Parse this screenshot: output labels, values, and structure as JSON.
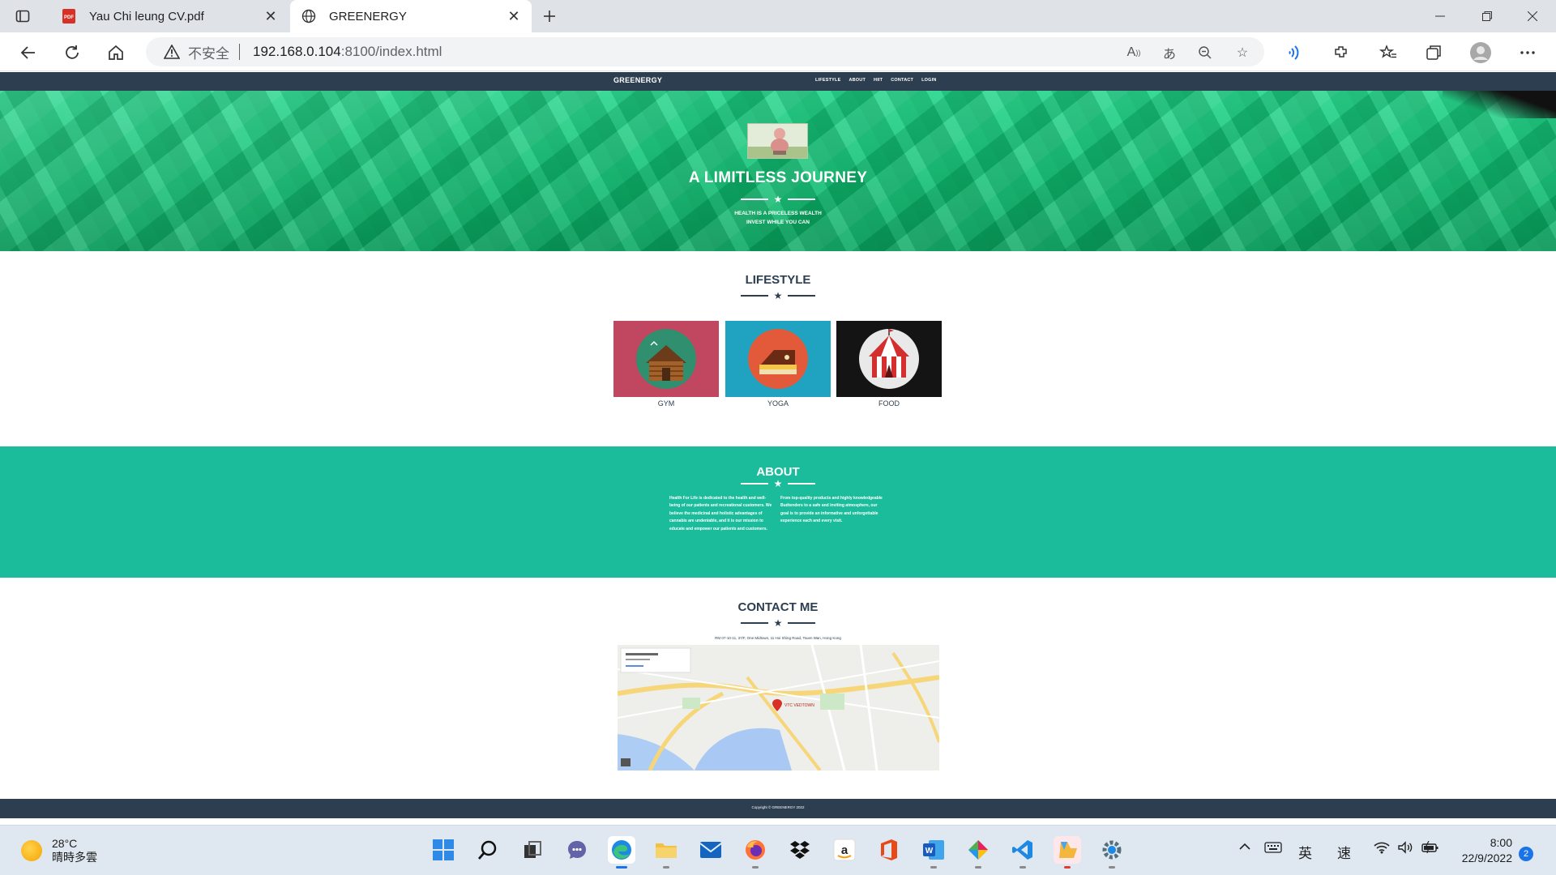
{
  "browser": {
    "tabs": [
      {
        "title": "Yau Chi leung CV.pdf",
        "icon": "pdf-icon"
      },
      {
        "title": "GREENERGY",
        "icon": "globe-icon"
      }
    ],
    "address": {
      "security": "不安全",
      "host": "192.168.0.104",
      "path": ":8100/index.html"
    }
  },
  "site": {
    "brand": "GREENERGY",
    "nav": [
      "LIFESTYLE",
      "ABOUT",
      "HIIT",
      "CONTACT",
      "LOGIN"
    ],
    "hero": {
      "title": "A LIMITLESS JOURNEY",
      "subtitle_line1": "HEALTH IS A PRICELESS WEALTH",
      "subtitle_line2": "INVEST WHILE YOU CAN"
    },
    "lifestyle": {
      "title": "LIFESTYLE",
      "items": [
        {
          "label": "GYM",
          "bg": "#c0475f",
          "icon": "cabin-icon"
        },
        {
          "label": "YOGA",
          "bg": "#1fa3c0",
          "icon": "cake-icon"
        },
        {
          "label": "FOOD",
          "bg": "#141414",
          "icon": "circus-tent-icon"
        }
      ]
    },
    "about": {
      "title": "ABOUT",
      "col1": "Health For Life is dedicated to the health and well-being of our patients and recreational customers. We believe the medicinal and holistic advantages of cannabis are undeniable, and it is our mission to educate and empower our patients and customers.",
      "col2": "From top-quality products and highly knowledgeable Budtenders to a safe and inviting atmosphere, our goal is to provide an informative and unforgettable experience each and every visit."
    },
    "contact": {
      "title": "CONTACT ME",
      "address": "RM 07-10-11, 37/F, One Midtown, 11 Hoi Shing Road, Tsuen Wan, Hong Kong",
      "map_marker": "VTC VEDTOWN"
    },
    "footer": {
      "copyright": "Copyright © GREENERGY 2022"
    },
    "colors": {
      "navy": "#2c3e50",
      "teal": "#1abc9c",
      "hero_green": "#12c47a"
    }
  },
  "taskbar": {
    "weather": {
      "temp": "28°C",
      "condition": "晴時多雲"
    },
    "tray": {
      "ime1": "英",
      "ime2": "速"
    },
    "clock": {
      "time": "8:00",
      "date": "22/9/2022"
    },
    "notifications": "2"
  }
}
